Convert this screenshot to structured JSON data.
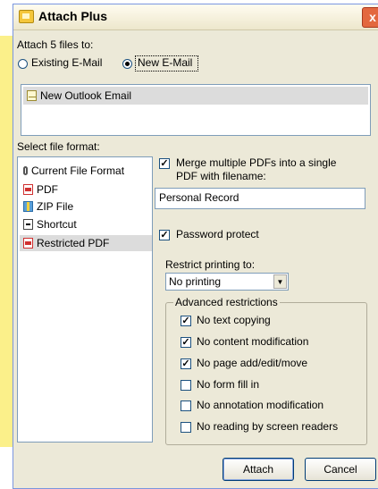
{
  "window": {
    "title": "Attach Plus",
    "close_glyph": "x"
  },
  "attach": {
    "heading": "Attach 5 files to:",
    "existing_email": "Existing E-Mail",
    "new_email": "New E-Mail",
    "selected": "new_email"
  },
  "destinations": [
    {
      "label": "New Outlook Email",
      "icon": "email-draft-icon"
    }
  ],
  "formats": {
    "heading": "Select file format:",
    "items": [
      {
        "label": "Current File Format",
        "icon": "paperclip-icon"
      },
      {
        "label": "PDF",
        "icon": "pdf-icon"
      },
      {
        "label": "ZIP File",
        "icon": "zip-icon"
      },
      {
        "label": "Shortcut",
        "icon": "shortcut-icon"
      },
      {
        "label": "Restricted PDF",
        "icon": "pdf-icon"
      }
    ],
    "selected_index": 4
  },
  "merge": {
    "label_line1": "Merge multiple PDFs into a single",
    "label_line2": "PDF with filename:",
    "checked": true,
    "filename": "Personal Record"
  },
  "password": {
    "label": "Password protect",
    "checked": true
  },
  "printing": {
    "label": "Restrict printing to:",
    "value": "No printing"
  },
  "advanced": {
    "title": "Advanced restrictions",
    "items": [
      {
        "label": "No text copying",
        "checked": true
      },
      {
        "label": "No content modification",
        "checked": true
      },
      {
        "label": "No page add/edit/move",
        "checked": true
      },
      {
        "label": "No form fill in",
        "checked": false
      },
      {
        "label": "No annotation modification",
        "checked": false
      },
      {
        "label": "No reading by screen readers",
        "checked": false
      }
    ]
  },
  "buttons": {
    "attach": "Attach",
    "cancel": "Cancel"
  },
  "check_mark": "✓"
}
